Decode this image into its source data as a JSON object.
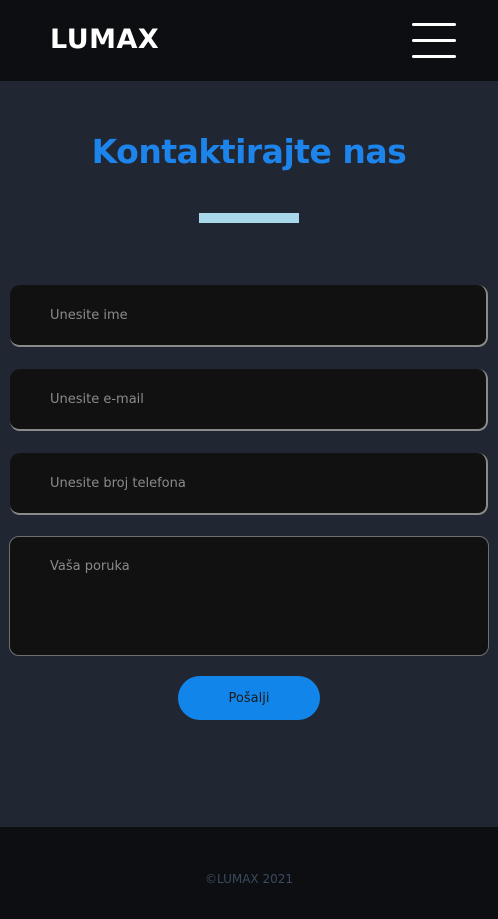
{
  "header": {
    "logo": "LUMAX",
    "menu_icon": "hamburger-menu-icon"
  },
  "contact": {
    "title": "Kontaktirajte nas",
    "name_placeholder": "Unesite ime",
    "email_placeholder": "Unesite e-mail",
    "phone_placeholder": "Unesite broj telefona",
    "message_placeholder": "Vaša poruka",
    "submit_label": "Pošalji"
  },
  "footer": {
    "copyright": "©LUMAX 2021"
  },
  "colors": {
    "accent": "#1d84ec",
    "button": "#1185e9",
    "underline": "#a8d8ea",
    "background": "#202733",
    "bar_background": "#0c0e12",
    "field_background": "#111111"
  }
}
